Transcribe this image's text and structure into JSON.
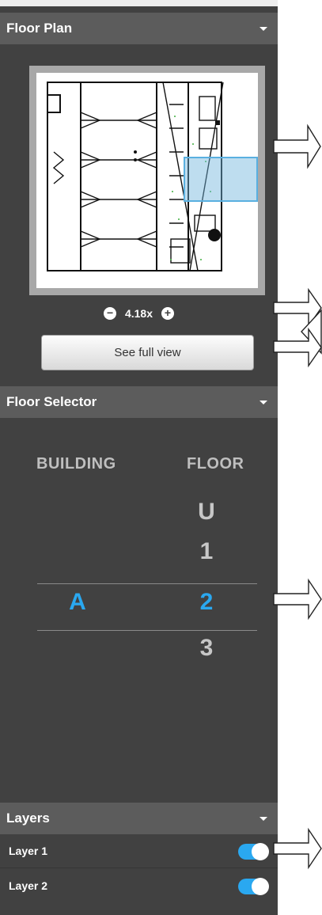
{
  "floor_plan": {
    "title": "Floor Plan",
    "zoom_level": "4.18x",
    "zoom_out_symbol": "−",
    "zoom_in_symbol": "+",
    "full_view_label": "See full view"
  },
  "floor_selector": {
    "title": "Floor Selector",
    "building_header": "BUILDING",
    "floor_header": "FLOOR",
    "selected_building": "A",
    "floors": [
      "U",
      "1",
      "2",
      "3"
    ],
    "selected_floor": "2"
  },
  "layers": {
    "title": "Layers",
    "items": [
      {
        "label": "Layer 1",
        "enabled": true
      },
      {
        "label": "Layer 2",
        "enabled": true
      }
    ]
  },
  "colors": {
    "accent": "#2aa8f0",
    "panel": "#414141",
    "header": "#5c5c5c"
  }
}
